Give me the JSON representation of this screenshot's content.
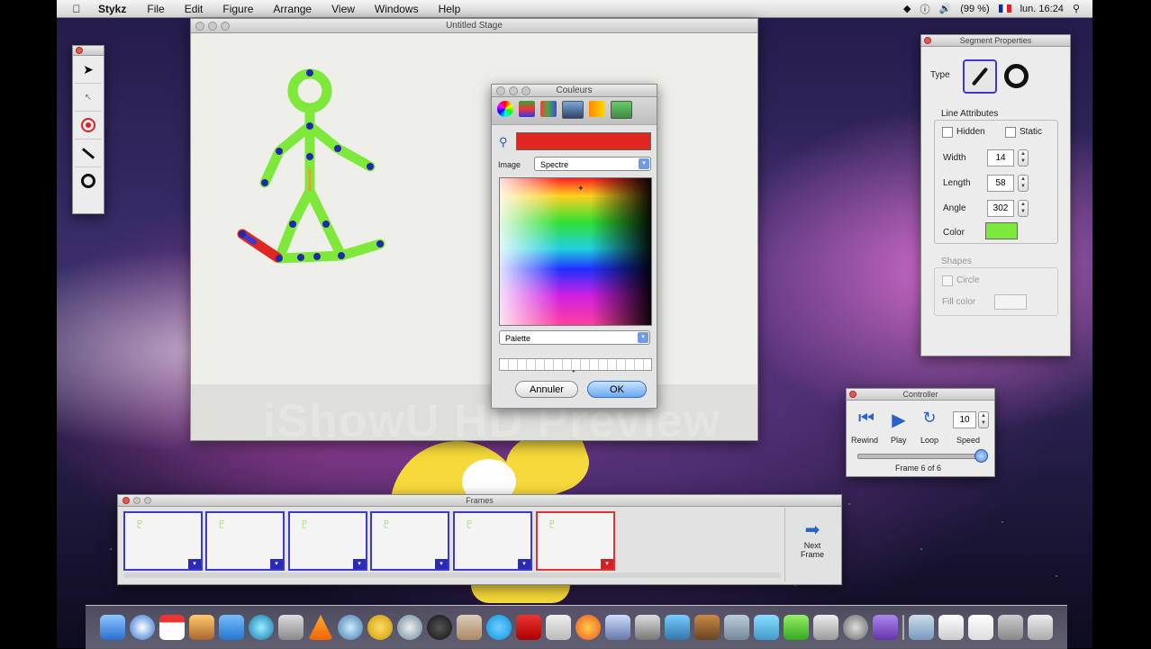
{
  "menubar": {
    "app": "Stykz",
    "items": [
      "File",
      "Edit",
      "Figure",
      "Arrange",
      "View",
      "Windows",
      "Help"
    ],
    "battery": "(99 %)",
    "clock": "lun. 16:24"
  },
  "stage": {
    "title": "Untitled Stage"
  },
  "colors_panel": {
    "title": "Couleurs",
    "current_color": "#e0261e",
    "image_label": "Image",
    "image_select": "Spectre",
    "palette_select": "Palette",
    "cancel": "Annuler",
    "ok": "OK"
  },
  "segment_properties": {
    "title": "Segment Properties",
    "type_label": "Type",
    "line_attributes": "Line Attributes",
    "hidden": "Hidden",
    "static": "Static",
    "width_label": "Width",
    "width": "14",
    "length_label": "Length",
    "length": "58",
    "angle_label": "Angle",
    "angle": "302",
    "color_label": "Color",
    "color": "#7ce83c",
    "shapes_label": "Shapes",
    "circle_label": "Circle",
    "fill_color_label": "Fill color"
  },
  "controller": {
    "title": "Controller",
    "rewind": "Rewind",
    "play": "Play",
    "loop": "Loop",
    "speed_label": "Speed",
    "speed": "10",
    "frame_status": "Frame 6 of 6"
  },
  "frames_panel": {
    "title": "Frames",
    "next_label_1": "Next",
    "next_label_2": "Frame"
  },
  "watermark": "iShowU HD Preview",
  "accent": "#3a3ad0"
}
